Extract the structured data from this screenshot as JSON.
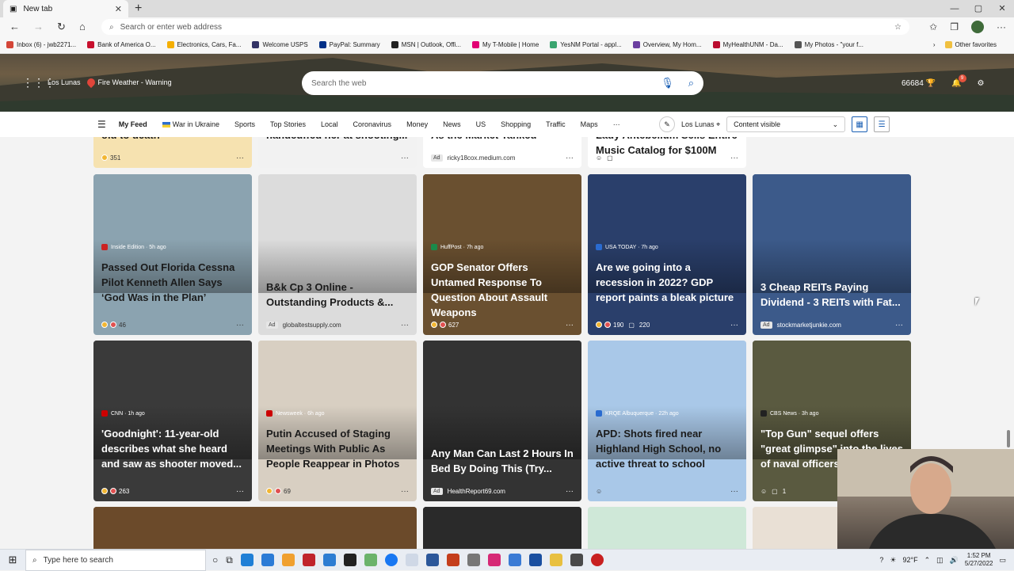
{
  "browser": {
    "tab_title": "New tab",
    "address_placeholder": "Search or enter web address",
    "favorites": [
      {
        "label": "Inbox (6) - jwb2271...",
        "color": "#d44638"
      },
      {
        "label": "Bank of America  O...",
        "color": "#c8102e"
      },
      {
        "label": "Electronics, Cars, Fa...",
        "color": "#f5af02"
      },
      {
        "label": "Welcome  USPS",
        "color": "#333366"
      },
      {
        "label": "PayPal: Summary",
        "color": "#003087"
      },
      {
        "label": "MSN | Outlook, Offi...",
        "color": "#222222"
      },
      {
        "label": "My T-Mobile | Home",
        "color": "#e20074"
      },
      {
        "label": "YesNM Portal - appl...",
        "color": "#3aa56f"
      },
      {
        "label": "Overview, My Hom...",
        "color": "#6b3fa0"
      },
      {
        "label": "MyHealthUNM - Da...",
        "color": "#ba0c2f"
      },
      {
        "label": "My Photos - \"your f...",
        "color": "#555555"
      }
    ],
    "other_favorites": "Other favorites"
  },
  "header": {
    "location": "Los Lunas",
    "alert": "Fire Weather - Warning",
    "search_placeholder": "Search the web",
    "points": "66684",
    "notifications": "9"
  },
  "feednav": {
    "items": [
      "My Feed",
      "War in Ukraine",
      "Sports",
      "Top Stories",
      "Local",
      "Coronavirus",
      "Money",
      "News",
      "US",
      "Shopping",
      "Traffic",
      "Maps"
    ],
    "more": "···",
    "location": "Los Lunas",
    "content_select": "Content visible"
  },
  "top_partial": [
    {
      "title": "old to death",
      "count": "351"
    },
    {
      "title": "handcuffed her at shooting..."
    },
    {
      "title": "As the Market Tanked",
      "source": "ricky18cox.medium.com",
      "ad": "Ad"
    },
    {
      "title": "Lady Antebellum Sells Entire Music Catalog for $100M"
    }
  ],
  "cards_row1": [
    {
      "source": "Inside Edition · 5h ago",
      "title": "Passed Out Florida Cessna Pilot Kenneth Allen Says ‘God Was in the Plan’",
      "count": "46",
      "color": "#8ba3b0",
      "srccolor": "#c22"
    },
    {
      "source": "globaltestsupply.com",
      "title": "B&k Cp 3 Online - Outstanding Products &...",
      "ad": "Ad",
      "color": "#dcdcdc",
      "srccolor": "#999"
    },
    {
      "source": "HuffPost · 7h ago",
      "title": "GOP Senator Offers Untamed Response To Question About Assault Weapons",
      "count": "627",
      "color": "#6a5030",
      "srccolor": "#1a8a4a"
    },
    {
      "source": "USA TODAY · 7h ago",
      "title": "Are we going into a recession in 2022? GDP report paints a bleak picture",
      "count": "190",
      "comments": "220",
      "color": "#2a3f6b",
      "srccolor": "#2a6bd0"
    },
    {
      "source": "stockmarketjunkie.com",
      "title": "3 Cheap REITs Paying Dividend - 3 REITs with Fat...",
      "ad": "Ad",
      "color": "#3c5a8a",
      "srccolor": "#999"
    }
  ],
  "cards_row2": [
    {
      "source": "CNN · 1h ago",
      "title": "'Goodnight': 11-year-old describes what she heard and saw as shooter moved...",
      "count": "263",
      "color": "#3a3a3a",
      "srccolor": "#c00"
    },
    {
      "source": "Newsweek · 6h ago",
      "title": "Putin Accused of Staging Meetings With Public As People Reappear in Photos",
      "count": "69",
      "color": "#d8cfc2",
      "srccolor": "#c00"
    },
    {
      "source": "HealthReport69.com",
      "title": "Any Man Can Last 2 Hours In Bed By Doing This (Try...",
      "ad": "Ad",
      "color": "#333",
      "srccolor": "#999"
    },
    {
      "source": "KRQE Albuquerque · 22h ago",
      "title": "APD: Shots fired near Highland High School, no active threat to school",
      "color": "#a9c8e8",
      "srccolor": "#2a6bd0"
    },
    {
      "source": "CBS News · 3h ago",
      "title": "\"Top Gun\" sequel offers \"great glimpse\" into the lives of naval officers",
      "comments": "1",
      "color": "#5a5a40",
      "srccolor": "#222"
    }
  ],
  "taskbar": {
    "search_placeholder": "Type here to search",
    "temp": "92°F",
    "time": "1:52 PM",
    "date": "5/27/2022"
  }
}
